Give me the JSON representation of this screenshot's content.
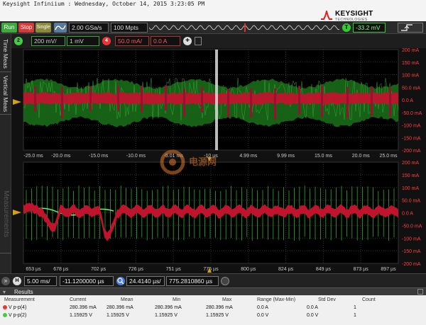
{
  "window": {
    "title": "Keysight Infiniium : Wednesday, October 14, 2015 3:23:05 PM"
  },
  "brand": {
    "name": "KEYSIGHT",
    "sub": "TECHNOLOGIES"
  },
  "toolbar": {
    "run_label": "Run",
    "stop_label": "Stop",
    "single_label": "Single",
    "sample_rate": "2.00 GSa/s",
    "memory_depth": "100 Mpts",
    "trigger_channel": "T",
    "trigger_level": "-33.2 mV"
  },
  "channels": {
    "ch2": {
      "number": "2",
      "scale": "200 mV/",
      "offset": "1 mV",
      "color": "#44cc44"
    },
    "ch4": {
      "number": "4",
      "scale": "50.0 mA/",
      "offset": "0.0 A",
      "color": "#ee3333"
    }
  },
  "side_tabs": {
    "time_meas": "Time Meas",
    "vertical_meas": "Vertical Meas",
    "measurements": "Measurements"
  },
  "upper_plot": {
    "x_ticks": [
      "-25.0 ms",
      "-20.0 ms",
      "-15.0 ms",
      "-10.0 ms",
      "-5.01 ms",
      "-10 µs",
      "4.99 ms",
      "9.99 ms",
      "15.0 ms",
      "20.0 ms",
      "25.0 ms"
    ],
    "y_ticks": [
      "200 mA",
      "150 mA",
      "100 mA",
      "50.0 mA",
      "0.0 A",
      "-50.0 mA",
      "-100 mA",
      "-150 mA",
      "-200 mA"
    ]
  },
  "lower_plot": {
    "x_ticks": [
      "653 µs",
      "678 µs",
      "702 µs",
      "726 µs",
      "751 µs",
      "775 µs",
      "800 µs",
      "824 µs",
      "849 µs",
      "873 µs",
      "897 µs"
    ],
    "y_ticks": [
      "200 mA",
      "150 mA",
      "100 mA",
      "50.0 mA",
      "0.0 A",
      "-50.0 mA",
      "-100 mA",
      "-150 mA",
      "-200 mA"
    ]
  },
  "timebase": {
    "h_label": "H",
    "scale": "5.00 ms/",
    "position": "-11.1200000 µs",
    "zoom_scale": "24.4140 µs/",
    "zoom_position": "775.2810860 µs"
  },
  "results": {
    "title": "Results",
    "columns": [
      "Measurement",
      "Current",
      "Mean",
      "Min",
      "Max",
      "Range (Max-Min)",
      "Std Dev",
      "Count"
    ],
    "rows": [
      {
        "color": "#ee3333",
        "cells": [
          "V p-p(4)",
          "280.396 mA",
          "280.396 mA",
          "280.396 mA",
          "280.396 mA",
          "0.0 A",
          "0.0 A",
          "1"
        ]
      },
      {
        "color": "#44cc44",
        "cells": [
          "V p-p(2)",
          "1.15925 V",
          "1.15925 V",
          "1.15925 V",
          "1.15925 V",
          "0.0 V",
          "0.0 V",
          "1"
        ]
      }
    ]
  },
  "watermark": "电源网"
}
